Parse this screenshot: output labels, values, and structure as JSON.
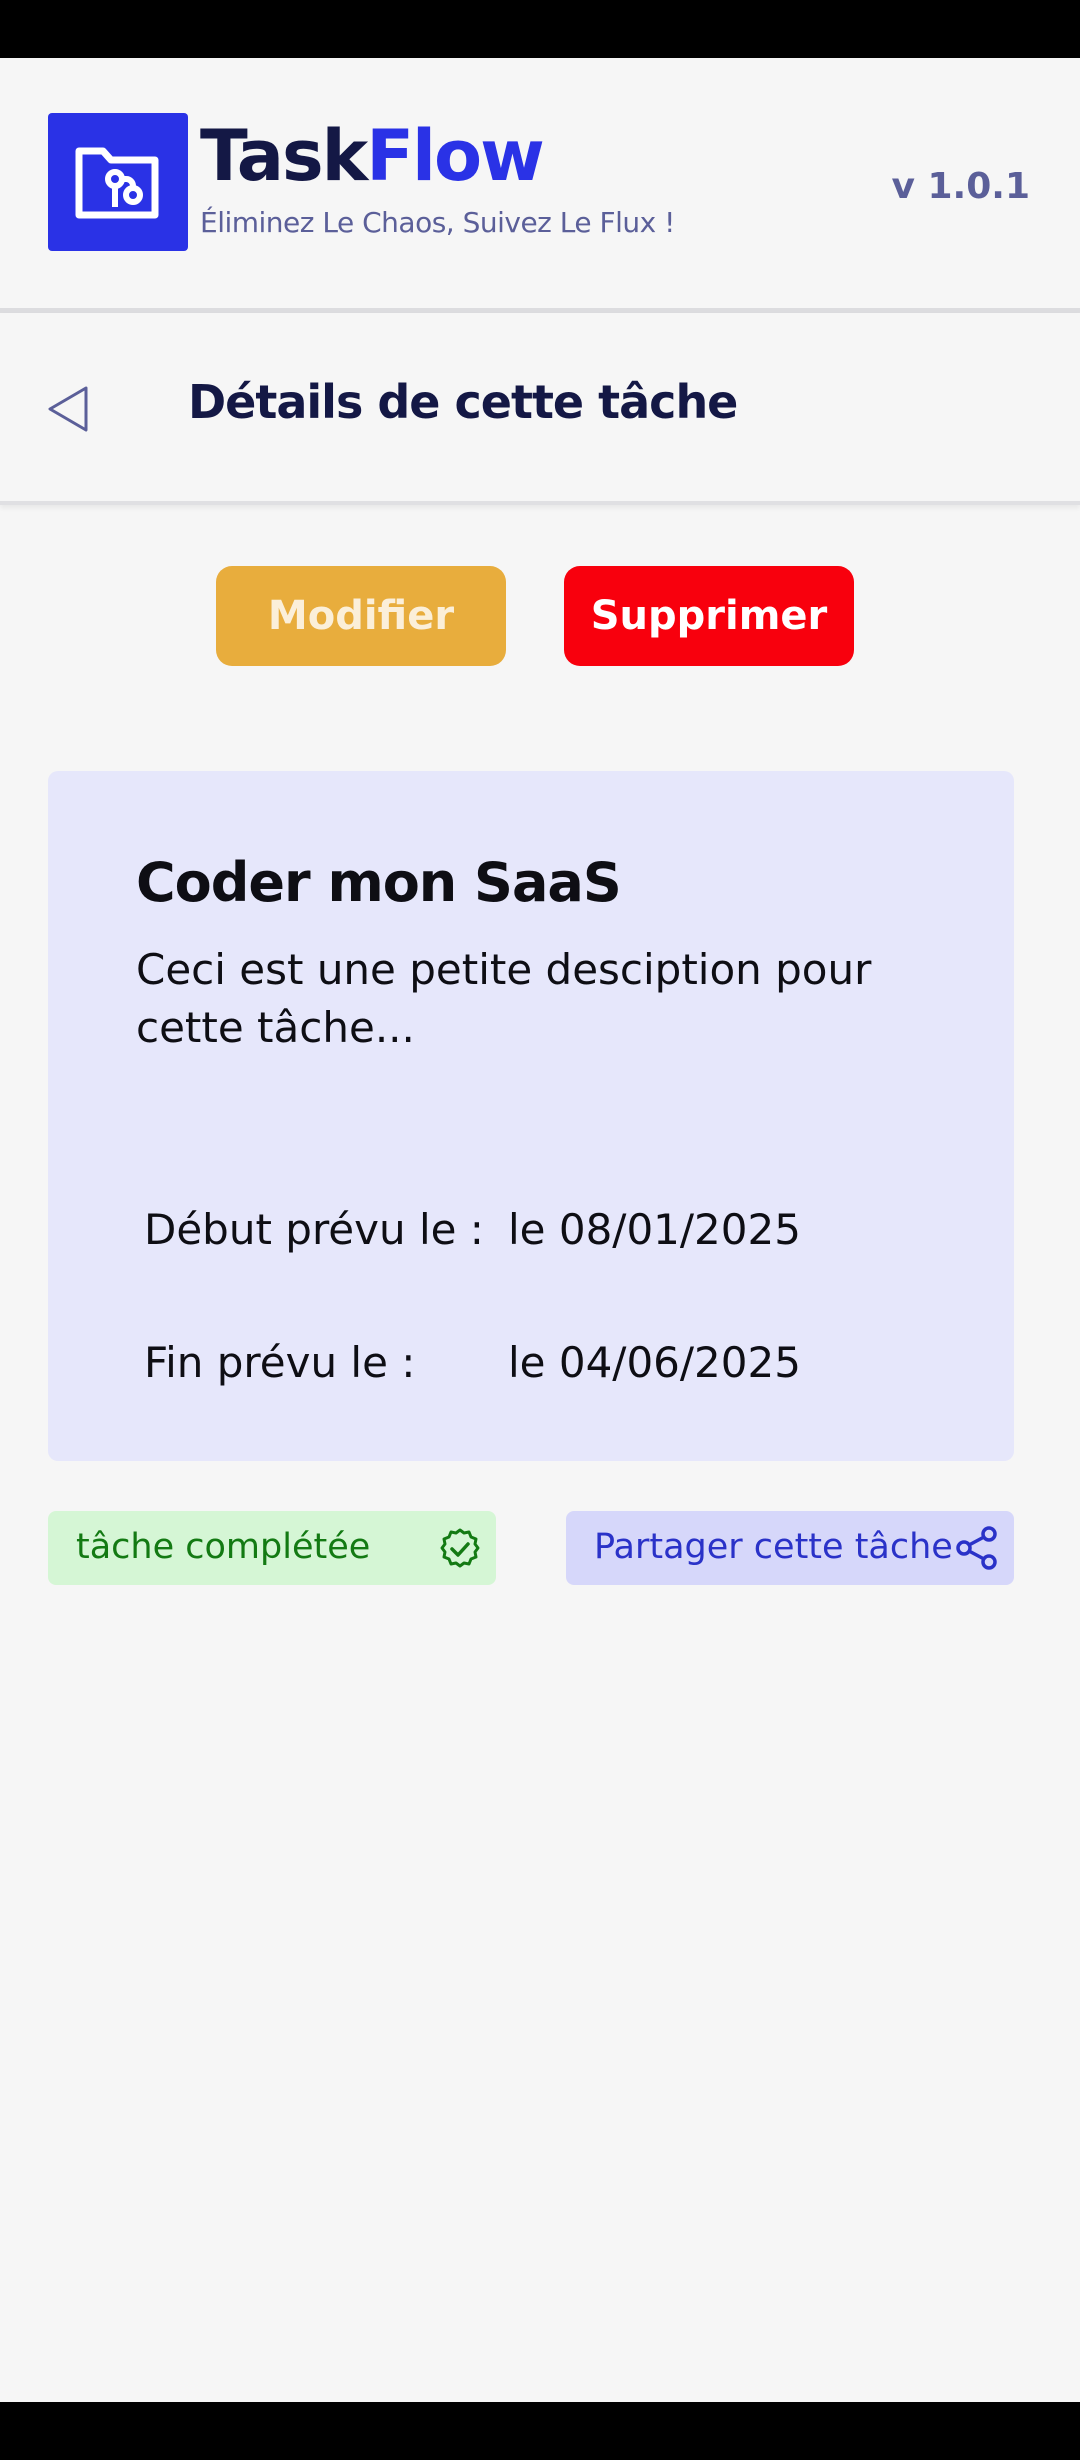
{
  "header": {
    "brand_part1": "Task",
    "brand_part2": "Flow",
    "tagline": "Éliminez Le Chaos, Suivez Le Flux !",
    "version": "v 1.0.1",
    "logo_icon": "folder-git-icon"
  },
  "nav": {
    "back_icon": "back-triangle-icon",
    "title": "Détails de cette tâche"
  },
  "actions": {
    "edit_label": "Modifier",
    "delete_label": "Supprimer"
  },
  "task": {
    "title": "Coder mon SaaS",
    "description": "Ceci est une petite desciption pour cette tâche...",
    "start_label": "Début prévu le :",
    "start_value": "le 08/01/2025",
    "end_label": "Fin prévu le :",
    "end_value": "le 04/06/2025"
  },
  "status": {
    "label": "tâche complétée",
    "icon": "check-badge-icon"
  },
  "share": {
    "label": "Partager cette tâche",
    "icon": "share-icon"
  },
  "colors": {
    "brand_blue": "#2a32e6",
    "dark_navy": "#141845",
    "edit_yellow": "#e8ad3d",
    "delete_red": "#f8000d",
    "card_bg": "#e6e7fb",
    "success_bg": "#d5f6d5",
    "success_text": "#137a13",
    "share_bg": "#d6d7fa"
  }
}
